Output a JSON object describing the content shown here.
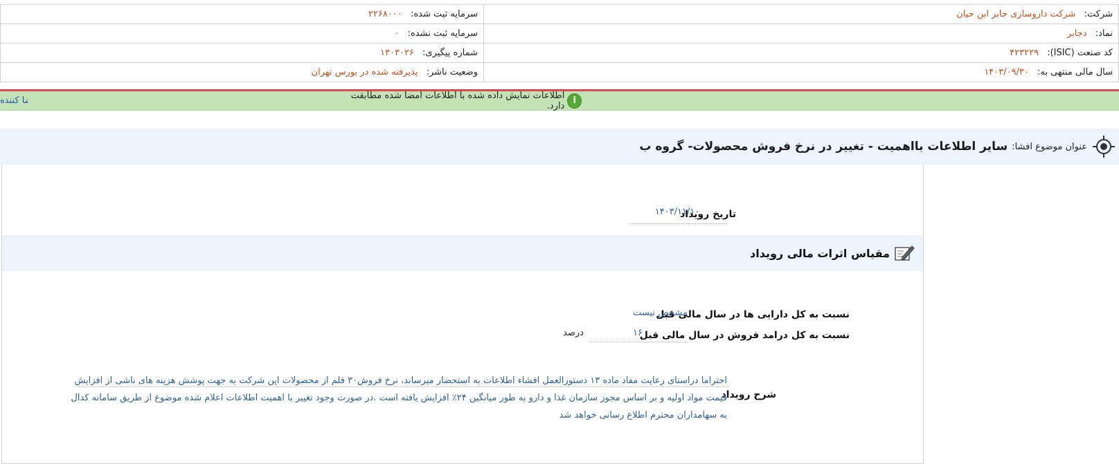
{
  "header": {
    "company_label": "شرکت:",
    "company_value": "شرکت داروسازی جابر ابن حیان",
    "registered_capital_label": "سرمایه ثبت شده:",
    "registered_capital_value": "۲۲۶۸۰۰۰",
    "symbol_label": "نماد:",
    "symbol_value": "دجابر",
    "unregistered_capital_label": "سرمایه ثبت نشده:",
    "unregistered_capital_value": "۰",
    "isic_label": "کد صنعت (ISIC):",
    "isic_value": "۴۲۳۲۲۹",
    "tracking_label": "شماره پیگیری:",
    "tracking_value": "۱۳۰۳۰۲۶",
    "fiscal_year_label": "سال مالی منتهی به:",
    "fiscal_year_value": "۱۴۰۳/۰۹/۳۰",
    "publisher_status_label": "وضعیت ناشر:",
    "publisher_status_value": "پذیرفته شده در بورس تهران"
  },
  "notice": {
    "message": "اطلاعات نمایش داده شده با اطلاعات امضا شده مطابقت دارد.",
    "sign_link": "امضا کننده",
    "icon": "info-icon",
    "icon_glyph": "i"
  },
  "subject": {
    "label": "عنوان موضوع افشا:",
    "title": "سایر اطلاعات بااهمیت - تغییر در نرخ فروش محصولات- گروه ب",
    "icon": "target-icon"
  },
  "event": {
    "date_label": "تاریخ رویداد",
    "date_value": "۱۴۰۳/۱۱/۱۰"
  },
  "financial_effects": {
    "section_title": "مقیاس اثرات مالی رویداد",
    "icon": "edit-icon",
    "assets_label": "نسبت به کل دارایی ها در سال مالی قبل",
    "assets_value": "مشخص نیست",
    "revenue_label": "نسبت به کل درامد فروش در سال مالی قبل",
    "revenue_value": "۱۶",
    "revenue_unit": "درصد"
  },
  "description": {
    "label": "شرح رویداد",
    "text": "احتراما دراستای رعایت مفاد ماده ۱۳ دستورالعمل افشاء اطلاعات به استحضار میرساند، نرخ فروش۳۰ قلم از محصولات این شرکت به جهت پوشش هزینه های ناشی از افزایش قیمت مواد اولیه و بر اساس مجوز سازمان غذا و دارو به طور میانگین ۲۴٪ افزایش یافته است .در صورت وجود تغییر با اهمیت اطلاعات اعلام شده موضوع از طریق سامانه کدال به سهامداران محترم اطلاع رسانی خواهد شد"
  },
  "colors": {
    "value_orange": "#c0501e",
    "value_blue": "#2f5f94",
    "notice_green": "#c5e2b6",
    "accent_red": "#e0474c",
    "bar_blue": "#edf4fb"
  }
}
